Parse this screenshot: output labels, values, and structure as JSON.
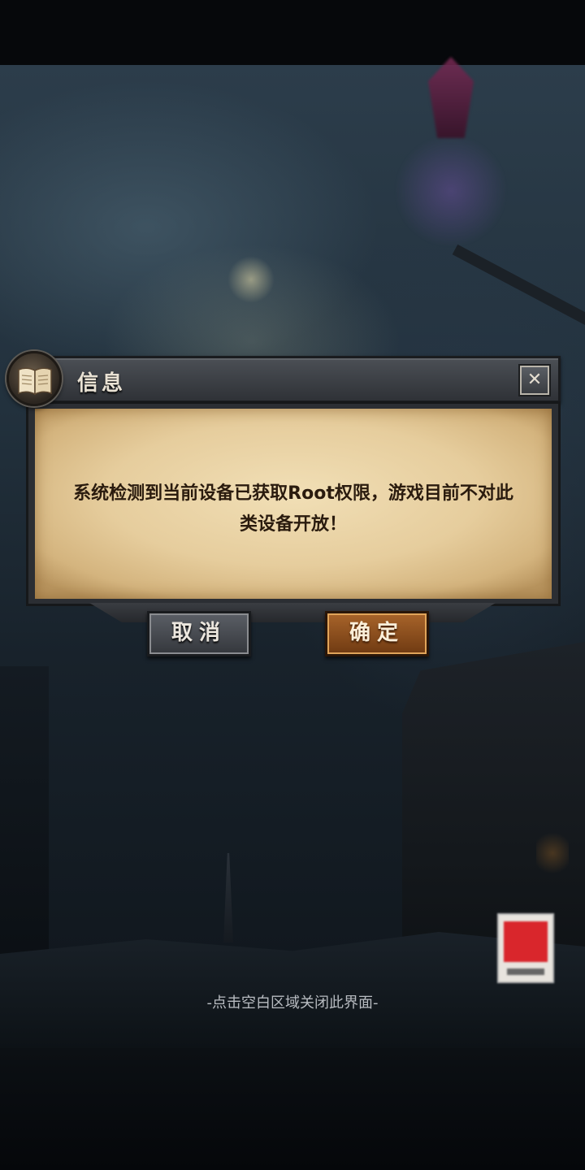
{
  "dialog": {
    "title": "信息",
    "message": "系统检测到当前设备已获取Root权限，游戏目前不对此类设备开放！",
    "cancel_label": "取消",
    "confirm_label": "确定",
    "close_icon": "close-icon",
    "header_icon": "book-icon"
  },
  "footer": {
    "hint": "-点击空白区域关闭此界面-"
  },
  "colors": {
    "parchment": "#e6cd9d",
    "confirm_button": "#a8642a",
    "cancel_button": "#4a4d53",
    "header": "#3f4247",
    "message_text": "#2a1b0e"
  }
}
